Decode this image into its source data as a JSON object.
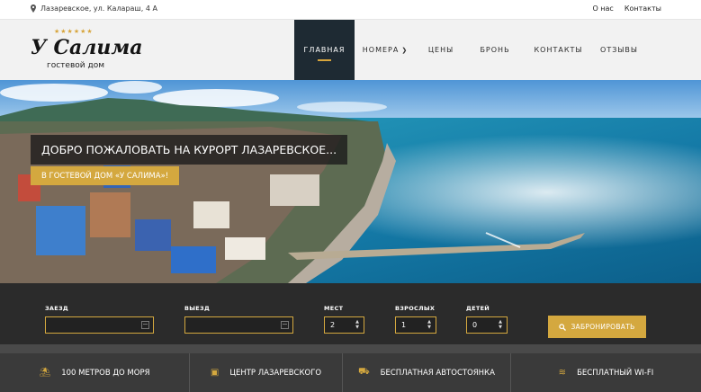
{
  "topbar": {
    "address": "Лазаревское, ул. Калараш, 4 А",
    "links": [
      "О нас",
      "Контакты"
    ]
  },
  "logo": {
    "stars": "★★★★★★",
    "title": "У Салима",
    "subtitle": "гостевой дом"
  },
  "nav": {
    "items": [
      "Главная",
      "Номера",
      "Цены",
      "Бронь",
      "Контакты",
      "Отзывы"
    ],
    "active_index": 0
  },
  "hero": {
    "title": "ДОБРО ПОЖАЛОВАТЬ НА КУРОРТ ЛАЗАРЕВСКОЕ...",
    "subtitle": "В ГОСТЕВОЙ ДОМ «У САЛИМА»!"
  },
  "booking": {
    "checkin_label": "ЗАЕЗД",
    "checkin_value": "",
    "checkout_label": "ВЫЕЗД",
    "checkout_value": "",
    "places_label": "МЕСТ",
    "places_value": "2",
    "adults_label": "ВЗРОСЛЫХ",
    "adults_value": "1",
    "children_label": "ДЕТЕЙ",
    "children_value": "0",
    "button_label": "ЗАБРОНИРОВАТЬ"
  },
  "features": [
    {
      "label": "100 МЕТРОВ ДО МОРЯ",
      "icon": "beach-icon"
    },
    {
      "label": "ЦЕНТР ЛАЗАРЕВСКОГО",
      "icon": "building-icon"
    },
    {
      "label": "БЕСПЛАТНАЯ АВТОСТОЯНКА",
      "icon": "car-icon"
    },
    {
      "label": "БЕСПЛАТНЫЙ WI-FI",
      "icon": "wifi-icon"
    }
  ],
  "colors": {
    "accent": "#d4a83f",
    "nav_active": "#1e2a33",
    "booking_bg": "#2b2b2b",
    "features_bg": "#3a3a3a"
  }
}
